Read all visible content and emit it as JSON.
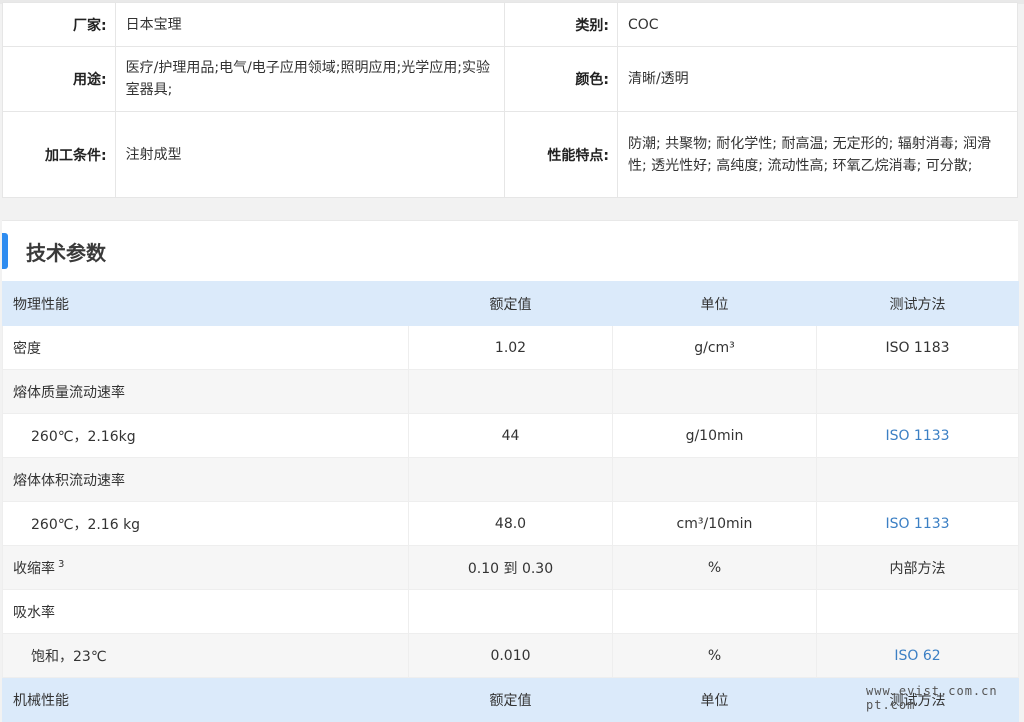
{
  "spec": {
    "rows": [
      {
        "label1": "厂家:",
        "value1": "日本宝理",
        "label2": "类别:",
        "value2": "COC"
      },
      {
        "label1": "用途:",
        "value1": "医疗/护理用品;电气/电子应用领域;照明应用;光学应用;实验室器具;",
        "label2": "颜色:",
        "value2": "清晰/透明"
      },
      {
        "label1": "加工条件:",
        "value1": "注射成型",
        "label2": "性能特点:",
        "value2": "防潮; 共聚物; 耐化学性; 耐高温; 无定形的; 辐射消毒; 润滑性; 透光性好; 高纯度; 流动性高; 环氧乙烷消毒; 可分散;"
      }
    ]
  },
  "tech": {
    "title": "技术参数",
    "header": {
      "c1": "物理性能",
      "c2": "额定值",
      "c3": "单位",
      "c4": "测试方法"
    },
    "rows": [
      {
        "c1": "密度",
        "c2": "1.02",
        "c3": "g/cm³",
        "c4": "ISO 1183",
        "link": false
      },
      {
        "c1": "熔体质量流动速率",
        "c2": "",
        "c3": "",
        "c4": "",
        "link": false
      },
      {
        "c1": "260℃，2.16kg",
        "c2": "44",
        "c3": "g/10min",
        "c4": "ISO 1133",
        "link": true
      },
      {
        "c1": "熔体体积流动速率",
        "c2": "",
        "c3": "",
        "c4": "",
        "link": false
      },
      {
        "c1": "260℃，2.16 kg",
        "c2": "48.0",
        "c3": "cm³/10min",
        "c4": "ISO 1133",
        "link": true
      },
      {
        "c1": "收缩率",
        "sup": "3",
        "c2": "0.10 到 0.30",
        "c3": "%",
        "c4": "内部方法",
        "link": false
      },
      {
        "c1": "吸水率",
        "c2": "",
        "c3": "",
        "c4": "",
        "link": false
      },
      {
        "c1": "饱和，23℃",
        "c2": "0.010",
        "c3": "%",
        "c4": "ISO 62",
        "link": true
      }
    ],
    "header2": {
      "c1": "机械性能",
      "c2": "额定值",
      "c3": "单位",
      "c4": "测试方法"
    }
  },
  "watermark": "www.evist.com.cn pt.com"
}
